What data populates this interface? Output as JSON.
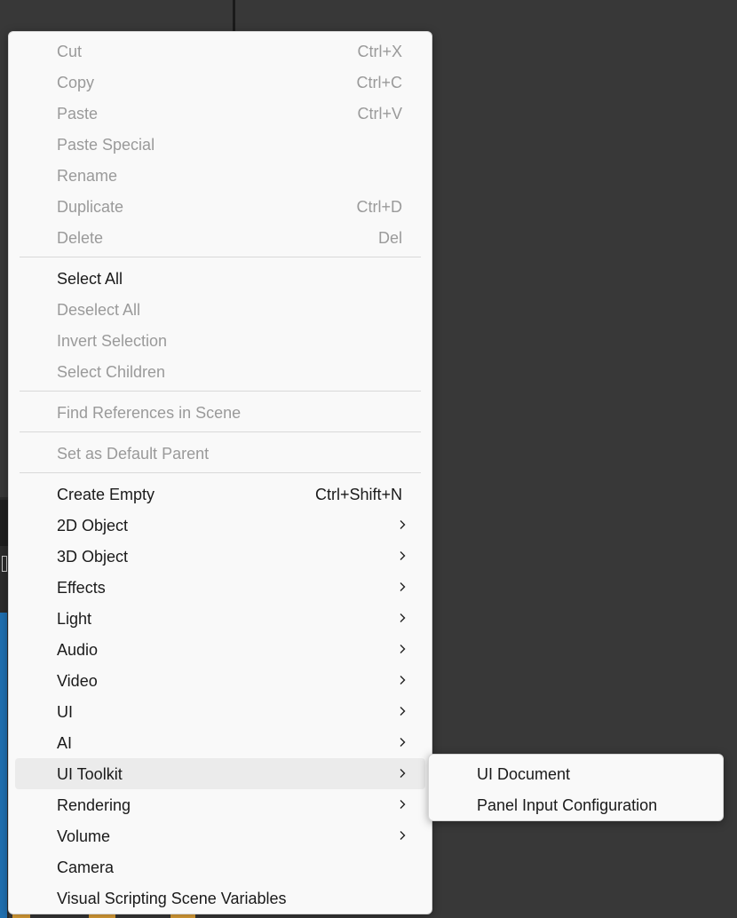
{
  "context_menu": {
    "edit_group": [
      {
        "label": "Cut",
        "shortcut": "Ctrl+X"
      },
      {
        "label": "Copy",
        "shortcut": "Ctrl+C"
      },
      {
        "label": "Paste",
        "shortcut": "Ctrl+V"
      },
      {
        "label": "Paste Special",
        "shortcut": ""
      },
      {
        "label": "Rename",
        "shortcut": ""
      },
      {
        "label": "Duplicate",
        "shortcut": "Ctrl+D"
      },
      {
        "label": "Delete",
        "shortcut": "Del"
      }
    ],
    "selection_group": [
      {
        "label": "Select All"
      },
      {
        "label": "Deselect All"
      },
      {
        "label": "Invert Selection"
      },
      {
        "label": "Select Children"
      }
    ],
    "find_references": {
      "label": "Find References in Scene"
    },
    "default_parent": {
      "label": "Set as Default Parent"
    },
    "create_group": [
      {
        "label": "Create Empty",
        "shortcut": "Ctrl+Shift+N"
      },
      {
        "label": "2D Object"
      },
      {
        "label": "3D Object"
      },
      {
        "label": "Effects"
      },
      {
        "label": "Light"
      },
      {
        "label": "Audio"
      },
      {
        "label": "Video"
      },
      {
        "label": "UI"
      },
      {
        "label": "AI"
      },
      {
        "label": "UI Toolkit"
      },
      {
        "label": "Rendering"
      },
      {
        "label": "Volume"
      },
      {
        "label": "Camera"
      },
      {
        "label": "Visual Scripting Scene Variables"
      }
    ]
  },
  "submenu": {
    "parent": "UI Toolkit",
    "items": [
      {
        "label": "UI Document"
      },
      {
        "label": "Panel Input Configuration"
      }
    ]
  },
  "icons": {
    "submenu_arrow": "chevron-right-icon"
  },
  "colors": {
    "menu_bg": "#f9f9f9",
    "disabled_text": "#9a9a9a",
    "highlight": "#ebebeb",
    "editor_bg": "#383838"
  }
}
